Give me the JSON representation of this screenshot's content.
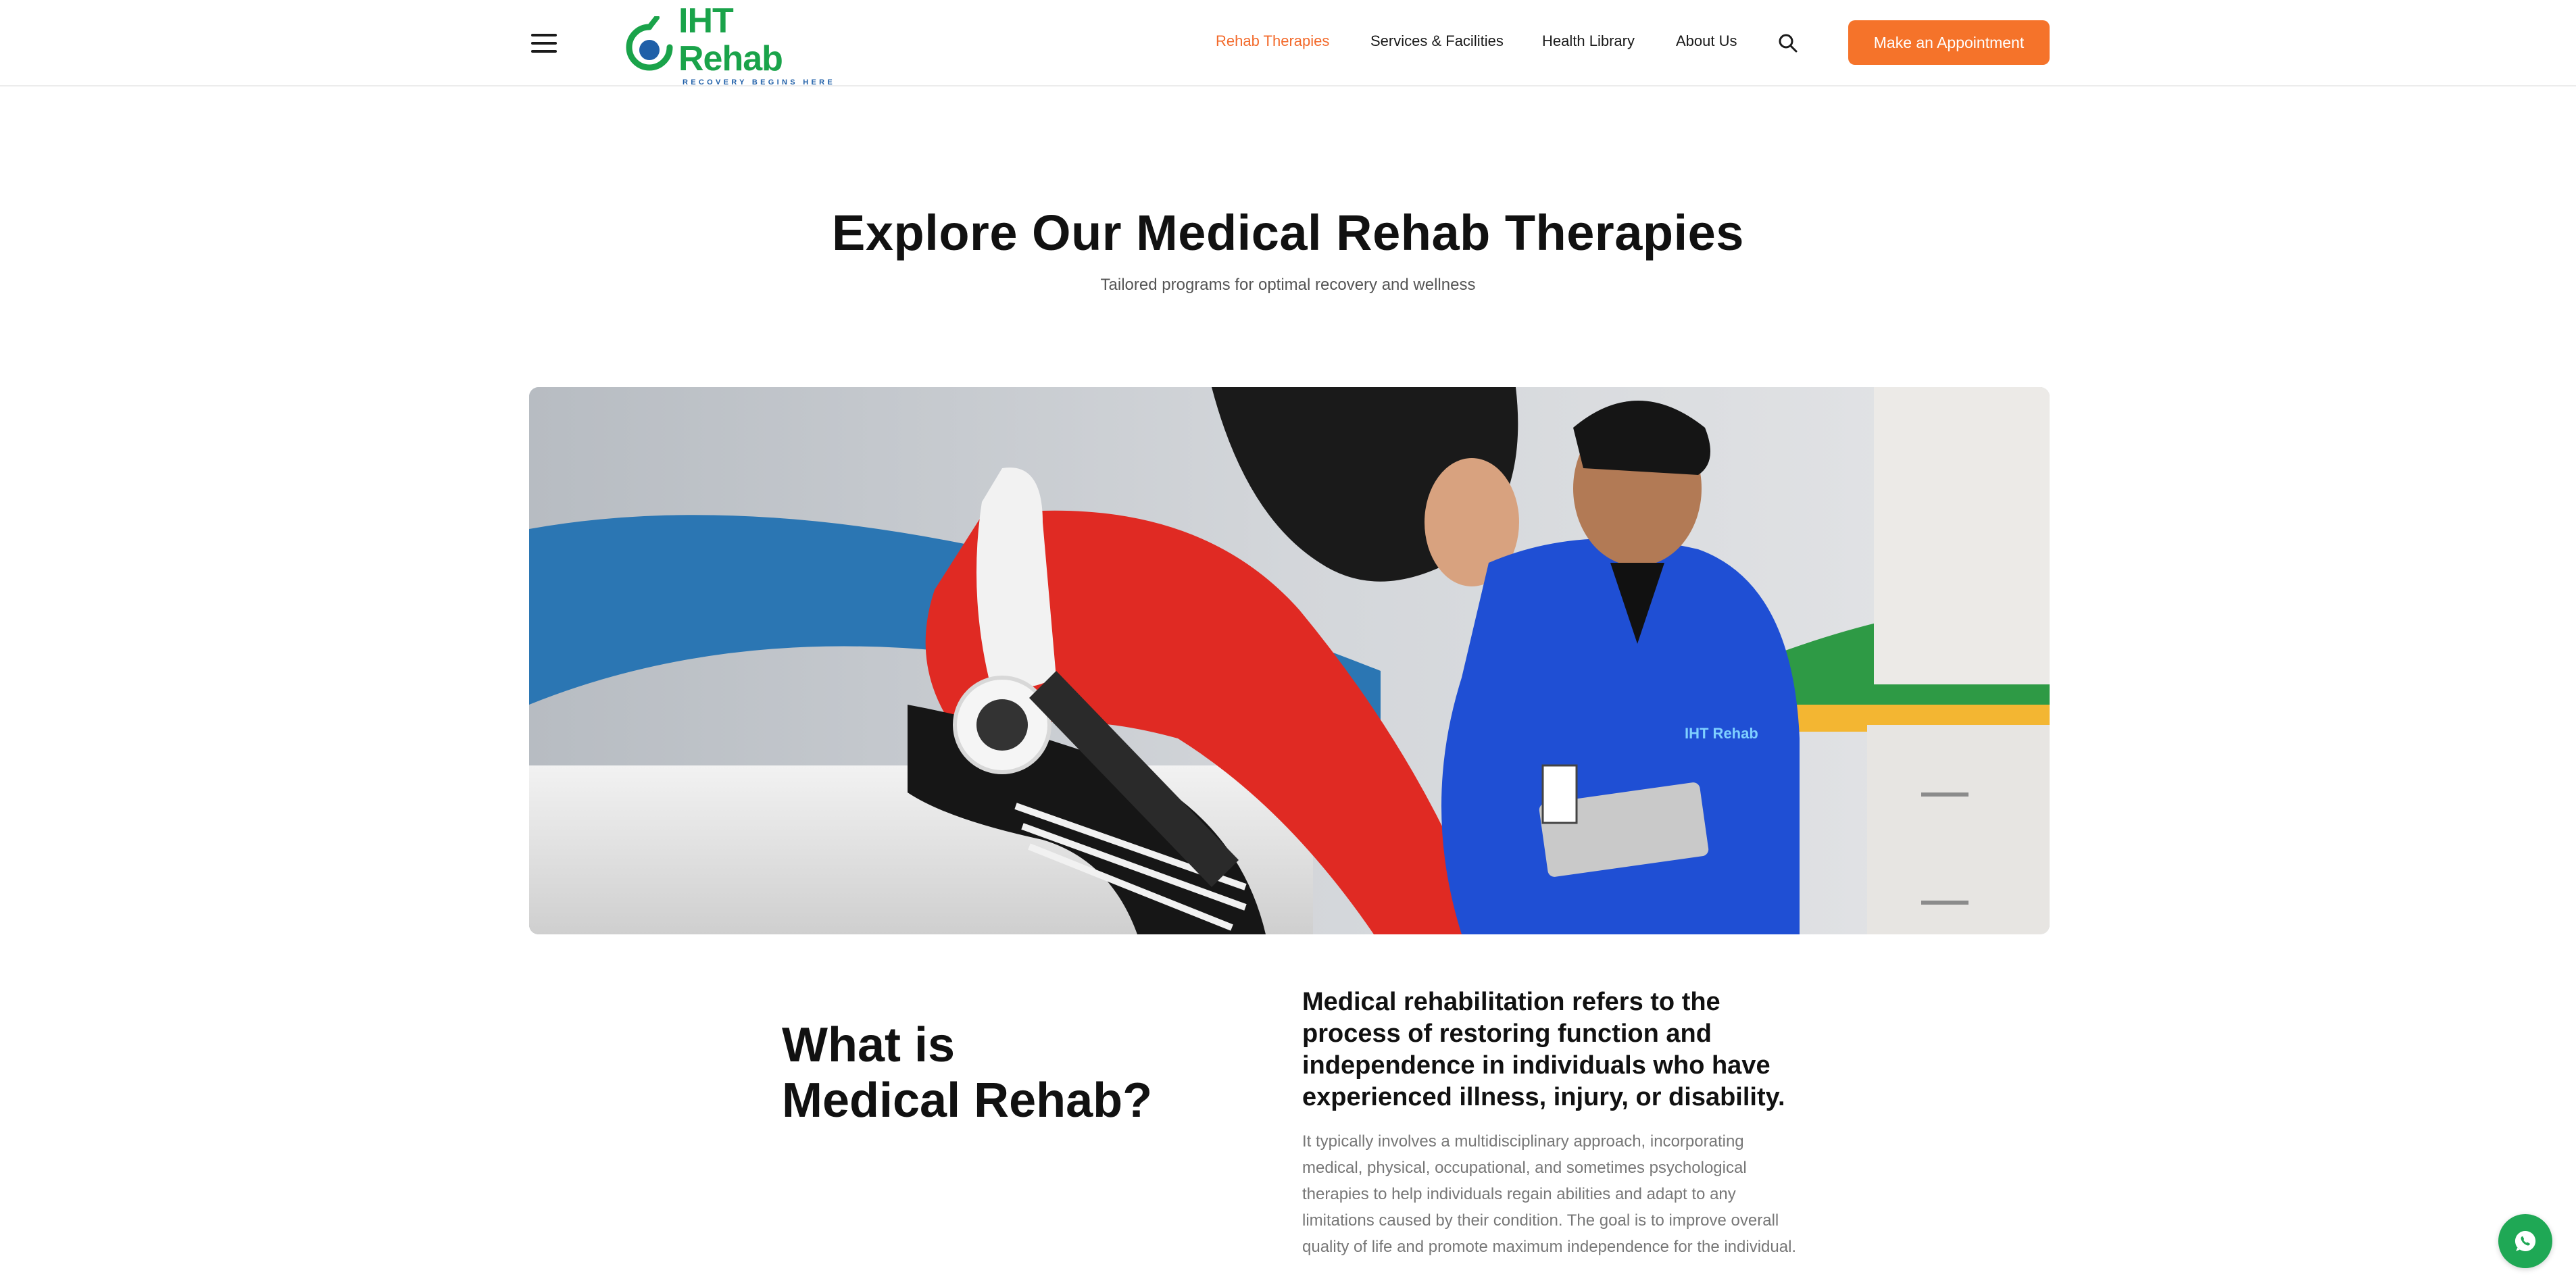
{
  "header": {
    "logo_name": "IHT Rehab",
    "logo_tagline": "RECOVERY BEGINS HERE",
    "nav": [
      {
        "label": "Rehab Therapies",
        "active": true
      },
      {
        "label": "Services & Facilities",
        "active": false
      },
      {
        "label": "Health Library",
        "active": false
      },
      {
        "label": "About Us",
        "active": false
      }
    ],
    "cta_label": "Make an Appointment"
  },
  "hero": {
    "title": "Explore Our Medical Rehab Therapies",
    "subtitle": "Tailored programs for optimal recovery and wellness"
  },
  "about": {
    "title_line1": "What is",
    "title_line2": "Medical Rehab?",
    "lead": "Medical rehabilitation refers to the process of restoring function and independence in individuals who have experienced illness, injury, or disability.",
    "body": "It typically involves a multidisciplinary approach, incorporating medical, physical, occupational, and sometimes psychological therapies to help individuals regain abilities and adapt to any limitations caused by their condition. The goal is to improve overall quality of life and promote maximum independence for the individual."
  },
  "icons": {
    "menu": "hamburger-menu-icon",
    "search": "search-icon",
    "chat": "whatsapp-icon"
  },
  "colors": {
    "brand_green": "#1aa34a",
    "brand_blue": "#1f5fa8",
    "accent_orange": "#f5732a",
    "whatsapp_green": "#1fa855"
  }
}
